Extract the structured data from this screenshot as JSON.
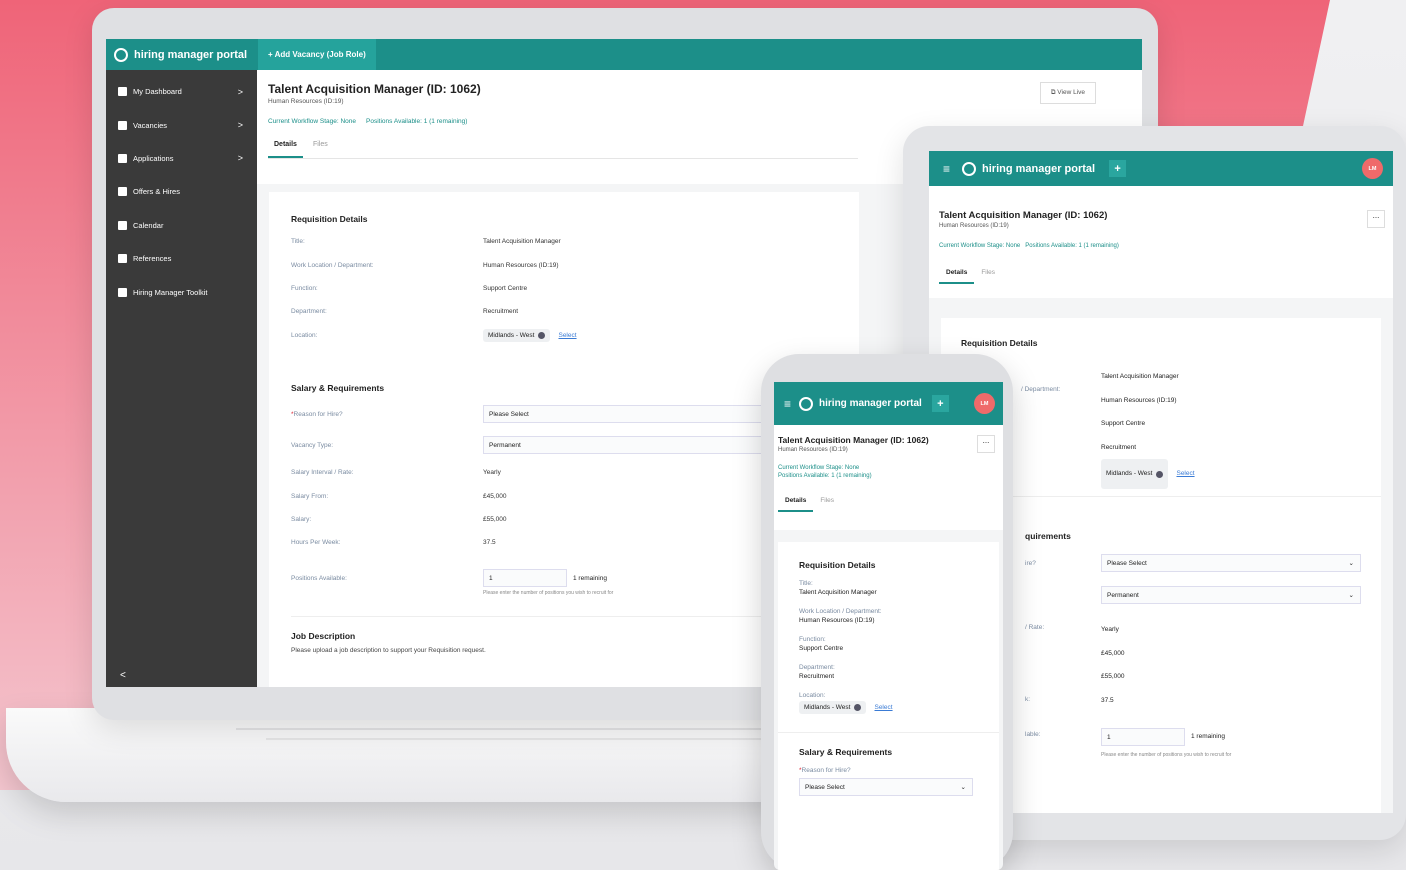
{
  "app": {
    "brand": "hiring manager portal",
    "add_vacancy": "+ Add Vacancy (Job Role)",
    "avatar": "LM"
  },
  "sidebar": {
    "items": [
      {
        "label": "My Dashboard",
        "icon": "dashboard-icon",
        "chevron": ">"
      },
      {
        "label": "Vacancies",
        "icon": "list-icon",
        "chevron": ">"
      },
      {
        "label": "Applications",
        "icon": "person-icon",
        "chevron": ">"
      },
      {
        "label": "Offers & Hires",
        "icon": "briefcase-icon",
        "chevron": ""
      },
      {
        "label": "Calendar",
        "icon": "calendar-icon",
        "chevron": ""
      },
      {
        "label": "References",
        "icon": "document-icon",
        "chevron": ""
      },
      {
        "label": "Hiring Manager Toolkit",
        "icon": "toolkit-icon",
        "chevron": ""
      }
    ],
    "collapse": "<"
  },
  "vacancy": {
    "title": "Talent Acquisition Manager (ID: 1062)",
    "department": "Human Resources (ID:19)",
    "workflow": "Current Workflow Stage: None",
    "positions": "Positions Available: 1 (1 remaining)",
    "view_live": "View Live"
  },
  "tabs": [
    "Details",
    "Files"
  ],
  "requisition": {
    "heading": "Requisition Details",
    "rows": [
      {
        "k": "Title:",
        "v": "Talent Acquisition Manager"
      },
      {
        "k": "Work Location / Department:",
        "v": "Human Resources (ID:19)"
      },
      {
        "k": "Function:",
        "v": "Support Centre"
      },
      {
        "k": "Department:",
        "v": "Recruitment"
      },
      {
        "k": "Location:",
        "v": "Midlands - West"
      }
    ],
    "select_link": "Select"
  },
  "salary": {
    "heading": "Salary & Requirements",
    "reason_label": "Reason for Hire?",
    "reason_value": "Please Select",
    "vacancy_type_label": "Vacancy Type:",
    "vacancy_type_value": "Permanent",
    "rows": [
      {
        "k": "Salary Interval / Rate:",
        "v": "Yearly"
      },
      {
        "k": "Salary From:",
        "v": "£45,000"
      },
      {
        "k": "Salary:",
        "v": "£55,000"
      },
      {
        "k": "Hours Per Week:",
        "v": "37.5"
      }
    ],
    "positions_label": "Positions Available:",
    "positions_value": "1",
    "remaining": "1 remaining",
    "hint": "Please enter the number of positions you wish to recruit for"
  },
  "job_description": {
    "heading": "Job Description",
    "text": "Please upload a job description to support your Requisition request."
  },
  "tablet": {
    "partial_labels": [
      "/ Department:",
      "quirements",
      "ire?",
      "",
      "/ Rate:",
      "",
      "",
      "k:",
      "lable:"
    ]
  },
  "phone": {
    "more": "..."
  }
}
